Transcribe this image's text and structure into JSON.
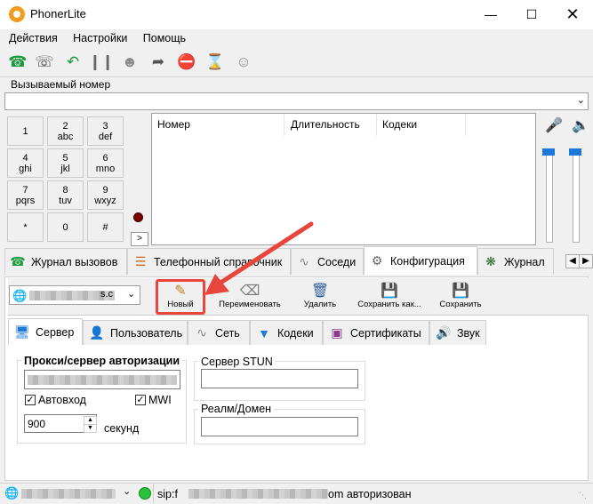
{
  "window": {
    "title": "PhonerLite"
  },
  "menu": [
    "Действия",
    "Настройки",
    "Помощь"
  ],
  "toolbar_icons": [
    "phone-call-icon",
    "phone-hold-icon",
    "phone-transfer-icon",
    "phone-pause-icon",
    "conference-icon",
    "forward-icon",
    "stop-icon",
    "phone-timer-icon",
    "users-icon"
  ],
  "called": {
    "label": "Вызываемый номер",
    "value": ""
  },
  "keypad": [
    {
      "d": "1",
      "l": ""
    },
    {
      "d": "2",
      "l": "abc"
    },
    {
      "d": "3",
      "l": "def"
    },
    {
      "d": "4",
      "l": "ghi"
    },
    {
      "d": "5",
      "l": "jkl"
    },
    {
      "d": "6",
      "l": "mno"
    },
    {
      "d": "7",
      "l": "pqrs"
    },
    {
      "d": "8",
      "l": "tuv"
    },
    {
      "d": "9",
      "l": "wxyz"
    },
    {
      "d": "*",
      "l": ""
    },
    {
      "d": "0",
      "l": ""
    },
    {
      "d": "#",
      "l": ""
    }
  ],
  "keypad_arrow": ">",
  "calllist": {
    "columns": [
      "Номер",
      "Длительность",
      "Кодеки"
    ]
  },
  "tabs": [
    "Журнал вызовов",
    "Телефонный справочник",
    "Соседи",
    "Конфигурация",
    "Журнал"
  ],
  "account": {
    "value_suffix": "s.c"
  },
  "actions": [
    "Новый",
    "Переименовать",
    "Удалить",
    "Сохранить как...",
    "Сохранить"
  ],
  "subtabs": [
    "Сервер",
    "Пользователь",
    "Сеть",
    "Кодеки",
    "Сертификаты",
    "Звук"
  ],
  "server": {
    "proxy_title": "Прокси/сервер авторизации",
    "autologin_label": "Автовход",
    "mwi_label": "MWI",
    "interval_value": "900",
    "seconds_label": "секунд",
    "stun_title": "Сервер STUN",
    "realm_title": "Реалм/Домен"
  },
  "status": {
    "sip_prefix": "sip:f",
    "sip_suffix": "om авторизован"
  },
  "colors": {
    "accent_green": "#1a9a3c",
    "highlight": "#e8453c",
    "slider": "#1e78d7"
  }
}
